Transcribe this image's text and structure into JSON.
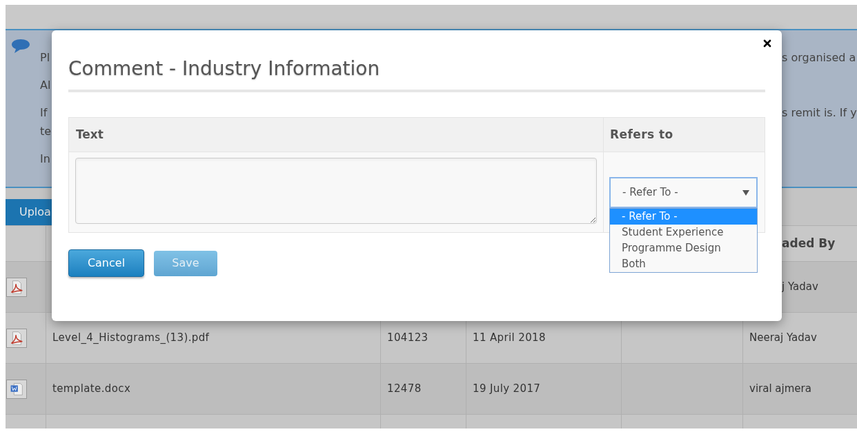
{
  "info_panel": {
    "paragraphs": [
      {
        "lines": [
          {
            "left": "Pl",
            "right": "s organised a"
          }
        ]
      },
      {
        "lines": [
          {
            "left": "Al"
          }
        ]
      },
      {
        "lines": [
          {
            "left": "If",
            "right": "s remit is. If y"
          },
          {
            "left": "te"
          }
        ]
      },
      {
        "lines": [
          {
            "left": "In"
          }
        ]
      }
    ]
  },
  "upload_button": "Uploa",
  "table": {
    "last_header": "aded By",
    "rows": [
      {
        "kind": "pdf",
        "uploaded_by": "j Yadav"
      },
      {
        "kind": "pdf",
        "name": "Level_4_Histograms_(13).pdf",
        "size": "104123",
        "date": "11 April 2018",
        "uploaded_by": "Neeraj Yadav"
      },
      {
        "kind": "word",
        "name": "template.docx",
        "size": "12478",
        "date": "19 July 2017",
        "uploaded_by": "viral ajmera"
      }
    ]
  },
  "modal": {
    "title": "Comment - Industry Information",
    "columns": [
      "Text",
      "Refers to"
    ],
    "select": {
      "value": "- Refer To -",
      "expanded": true,
      "options": [
        {
          "label": "- Refer To -",
          "selected": true
        },
        {
          "label": "Student Experience",
          "selected": false
        },
        {
          "label": "Programme Design",
          "selected": false
        },
        {
          "label": "Both",
          "selected": false
        }
      ]
    },
    "buttons": [
      {
        "label": "Cancel",
        "disabled": false
      },
      {
        "label": "Save",
        "disabled": true
      }
    ]
  }
}
